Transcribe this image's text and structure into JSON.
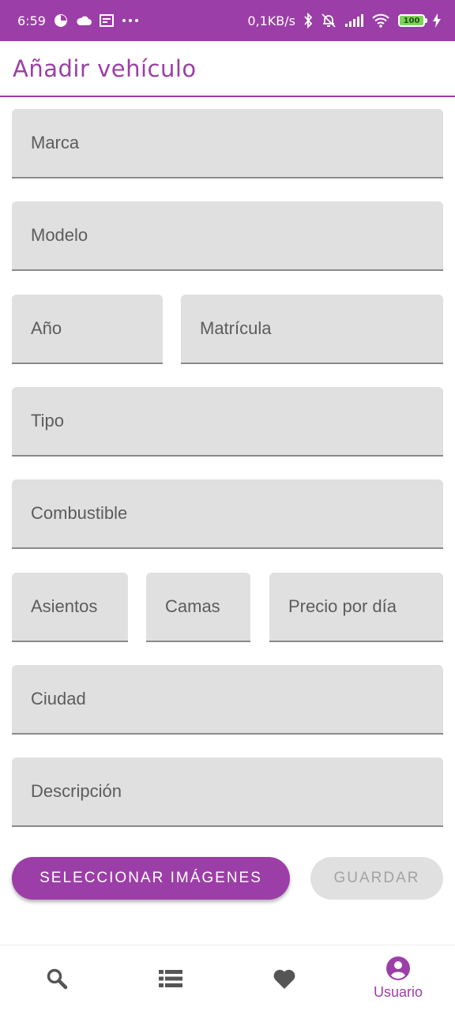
{
  "status_bar": {
    "time": "6:59",
    "network_speed": "0,1KB/s",
    "battery_level": "100",
    "icons": [
      "alarm-icon",
      "cloud-icon",
      "news-icon",
      "more-dots-icon",
      "bluetooth-icon",
      "mute-icon",
      "signal-icon",
      "wifi-icon",
      "battery-icon",
      "charging-icon"
    ]
  },
  "header": {
    "title": "Añadir vehículo"
  },
  "form": {
    "marca": "Marca",
    "modelo": "Modelo",
    "anio": "Año",
    "matricula": "Matrícula",
    "tipo": "Tipo",
    "combustible": "Combustible",
    "asientos": "Asientos",
    "camas": "Camas",
    "precio": "Precio por día",
    "ciudad": "Ciudad",
    "descripcion": "Descripción"
  },
  "actions": {
    "select_images": "SELECCIONAR IMÁGENES",
    "save": "GUARDAR"
  },
  "bottom_nav": {
    "items": [
      {
        "icon": "search-icon",
        "label": ""
      },
      {
        "icon": "list-icon",
        "label": ""
      },
      {
        "icon": "heart-icon",
        "label": ""
      },
      {
        "icon": "account-circle-icon",
        "label": "Usuario",
        "active": true
      }
    ]
  },
  "colors": {
    "primary": "#9c3ea7",
    "field_bg": "#e0e0e0",
    "inactive_icon": "#555555"
  }
}
